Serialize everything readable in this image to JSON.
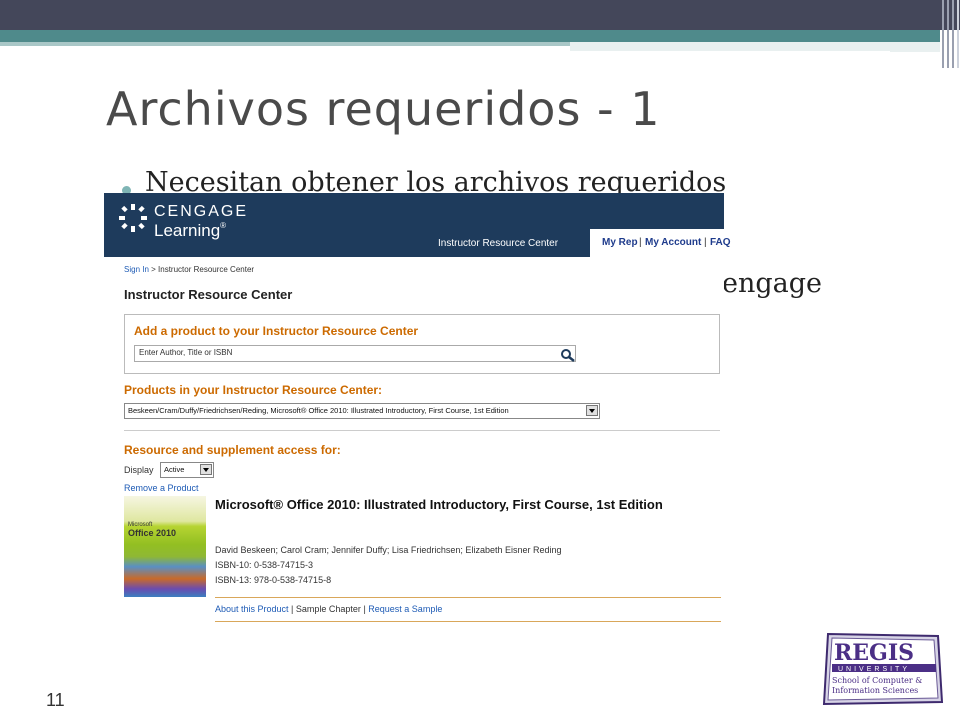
{
  "slide": {
    "title": "Archivos requeridos - 1",
    "bullet1_visible": "Necesitan obtener los archivos requeridos",
    "bullet2_visible": "engage",
    "slide_number": "11"
  },
  "cengage": {
    "logo_line1": "CENGAGE",
    "logo_line2": "Learning",
    "logo_mark": "®",
    "header_label": "Instructor Resource Center",
    "nav": {
      "my_rep": "My Rep",
      "my_account": "My Account",
      "faq": "FAQ",
      "sep": "|"
    },
    "breadcrumb": {
      "sign_in": "Sign In",
      "rest": " > Instructor Resource Center"
    },
    "page_title": "Instructor Resource Center",
    "add_product": {
      "heading": "Add a product to your Instructor Resource Center",
      "search_placeholder": "Enter Author, Title or ISBN"
    },
    "products": {
      "heading": "Products in your Instructor Resource Center:",
      "selected": "Beskeen/Cram/Duffy/Friedrichsen/Reding, Microsoft® Office 2010: Illustrated Introductory, First Course, 1st Edition"
    },
    "access": {
      "heading": "Resource and supplement access for:",
      "display_label": "Display",
      "display_value": "Active",
      "remove_link": "Remove a Product"
    },
    "book": {
      "cover_line1": "Microsoft",
      "cover_line2": "Office 2010",
      "title": "Microsoft® Office 2010: Illustrated Introductory, First Course, 1st Edition",
      "authors": "David Beskeen; Carol Cram; Jennifer Duffy; Lisa Friedrichsen; Elizabeth Eisner Reding",
      "isbn10": "ISBN-10: 0-538-74715-3",
      "isbn13": "ISBN-13: 978-0-538-74715-8",
      "links": {
        "about": "About this Product",
        "sample_chapter": "Sample Chapter",
        "request": "Request a Sample",
        "sep": " | "
      }
    }
  },
  "regis_logo": {
    "name": "REGIS",
    "university": "UNIVERSITY",
    "school1": "School of Computer &",
    "school2": "Information Sciences"
  },
  "colors": {
    "header_navy": "#1e3b5c",
    "accent_orange": "#cc6a00",
    "link_blue": "#1e5bb5",
    "slide_teal": "#4f8a8b"
  }
}
